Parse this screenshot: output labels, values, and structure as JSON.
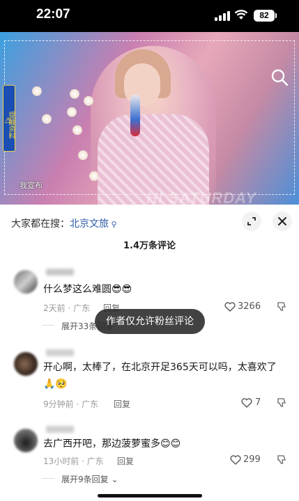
{
  "status": {
    "time": "22:07",
    "battery": "82"
  },
  "video": {
    "side_badge": "提醒资料",
    "caption": "我宣布",
    "watermark": "HI SATURDAY"
  },
  "hot_search": {
    "prefix": "大家都在搜：",
    "keyword": "北京文旅"
  },
  "comment_count": "1.4万条评论",
  "comments": [
    {
      "text": "什么梦这么难圆",
      "emoji": "😎😎",
      "time": "2天前",
      "location": "广东",
      "reply": "回复",
      "likes": "3266",
      "expand": "展开33条回复"
    },
    {
      "text": "开心啊，太棒了，在北京开足365天可以吗，太喜欢了",
      "emoji": "🙏🥺",
      "time": "9分钟前",
      "location": "广东",
      "reply": "回复",
      "likes": "7"
    },
    {
      "text": "去广西开吧，那边菠萝蜜多",
      "emoji": "😊😊",
      "time": "13小时前",
      "location": "广东",
      "reply": "回复",
      "likes": "299",
      "expand": "展开9条回复"
    }
  ],
  "toast": "作者仅允许粉丝评论",
  "icons": {
    "search": "search-icon",
    "expand": "expand-icon",
    "close": "close-icon",
    "like": "heart-outline-icon",
    "dislike": "dislike-icon"
  },
  "colors": {
    "link": "#2b5aa8",
    "meta": "#9a9a9a",
    "toast_bg": "#282828"
  }
}
